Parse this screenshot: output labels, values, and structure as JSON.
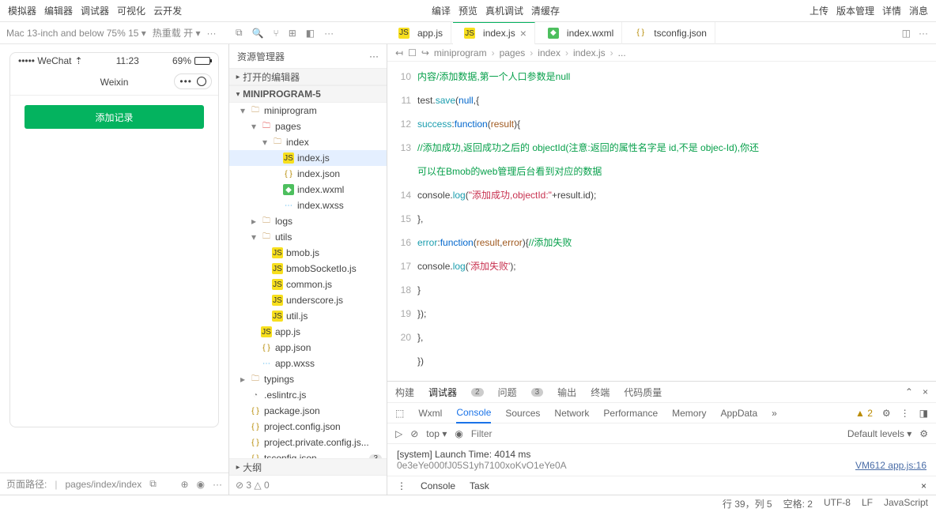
{
  "topmenu": {
    "left": [
      "模拟器",
      "编辑器",
      "调试器",
      "可视化",
      "云开发"
    ],
    "mid": [
      "编译",
      "预览",
      "真机调试",
      "清缓存"
    ],
    "right": [
      "上传",
      "版本管理",
      "详情",
      "消息"
    ]
  },
  "toolbar": {
    "device": "Mac 13-inch and below 75% 15 ▾",
    "reload": "热重载 开 ▾",
    "dots": "···"
  },
  "tabs": [
    {
      "label": "app.js",
      "icon": "js"
    },
    {
      "label": "index.js",
      "icon": "js",
      "active": true,
      "close": "×"
    },
    {
      "label": "index.wxml",
      "icon": "wxml"
    },
    {
      "label": "tsconfig.json",
      "icon": "json"
    }
  ],
  "phone": {
    "carrier": "••••• WeChat",
    "network": "⇡",
    "time": "11:23",
    "batt": "69%",
    "title": "Weixin",
    "btn": "添加记录"
  },
  "simstatus": {
    "label": "页面路径:",
    "path": "pages/index/index"
  },
  "explorer": {
    "title": "资源管理器",
    "open": "打开的编辑器",
    "root": "MINIPROGRAM-5",
    "outline": "大纲",
    "stat": "⊘ 3 △ 0",
    "tree": [
      {
        "pad": 1,
        "caret": "▾",
        "ico": "folder",
        "name": "miniprogram"
      },
      {
        "pad": 2,
        "caret": "▾",
        "ico": "folder",
        "name": "pages",
        "red": true
      },
      {
        "pad": 3,
        "caret": "▾",
        "ico": "folder",
        "name": "index"
      },
      {
        "pad": 4,
        "ico": "js",
        "name": "index.js",
        "sel": true
      },
      {
        "pad": 4,
        "ico": "json",
        "name": "index.json"
      },
      {
        "pad": 4,
        "ico": "wxml",
        "name": "index.wxml"
      },
      {
        "pad": 4,
        "ico": "wxss",
        "name": "index.wxss"
      },
      {
        "pad": 2,
        "caret": "▸",
        "ico": "folder",
        "name": "logs"
      },
      {
        "pad": 2,
        "caret": "▾",
        "ico": "folder",
        "name": "utils"
      },
      {
        "pad": 3,
        "ico": "js",
        "name": "bmob.js"
      },
      {
        "pad": 3,
        "ico": "js",
        "name": "bmobSocketIo.js"
      },
      {
        "pad": 3,
        "ico": "js",
        "name": "common.js"
      },
      {
        "pad": 3,
        "ico": "js",
        "name": "underscore.js"
      },
      {
        "pad": 3,
        "ico": "js",
        "name": "util.js"
      },
      {
        "pad": 2,
        "ico": "js",
        "name": "app.js"
      },
      {
        "pad": 2,
        "ico": "json",
        "name": "app.json"
      },
      {
        "pad": 2,
        "ico": "wxss",
        "name": "app.wxss"
      },
      {
        "pad": 1,
        "caret": "▸",
        "ico": "folder",
        "name": "typings"
      },
      {
        "pad": 1,
        "ico": "conf",
        "name": ".eslintrc.js"
      },
      {
        "pad": 1,
        "ico": "json",
        "name": "package.json"
      },
      {
        "pad": 1,
        "ico": "json",
        "name": "project.config.json"
      },
      {
        "pad": 1,
        "ico": "json",
        "name": "project.private.config.js..."
      },
      {
        "pad": 1,
        "ico": "json",
        "name": "tsconfig.json",
        "badge": "3"
      }
    ]
  },
  "crumbs": [
    "miniprogram",
    "pages",
    "index",
    "index.js",
    "..."
  ],
  "code": {
    "start": 10,
    "end": 20,
    "lines": [
      "内容/添加数据,第一个人口参数是null",
      "test.save(null,{",
      "success:function(result){",
      "//添加成功,返回成功之后的 objectId(注意:返回的属性名字是 id,不是 objec-Id),你还可以在Bmob的web管理后台看到对应的数据",
      "console.log(\"添加成功,objectId:\"+result.id);",
      "},",
      "error:function(result,error){//添加失败",
      "console.log('添加失败');",
      "}",
      "});",
      "},",
      "})"
    ]
  },
  "panel": {
    "tabs": [
      "构建",
      "调试器",
      "问题",
      "输出",
      "终端",
      "代码质量"
    ],
    "badge1": "2",
    "badge2": "3",
    "dev": [
      "Wxml",
      "Console",
      "Sources",
      "Network",
      "Performance",
      "Memory",
      "AppData"
    ],
    "warn": "▲ 2",
    "top": "top",
    "filter_ph": "Filter",
    "level": "Default levels ▾",
    "out1": "[system] Launch Time: 4014 ms",
    "out2": "0e3eYe000fJ05S1yh7100xoKvO1eYe0A",
    "link": "VM612 app.js:16",
    "drawer": [
      "Console",
      "Task"
    ]
  },
  "status": {
    "pos": "行 39，列 5",
    "spaces": "空格: 2",
    "enc": "UTF-8",
    "eol": "LF",
    "lang": "JavaScript"
  }
}
